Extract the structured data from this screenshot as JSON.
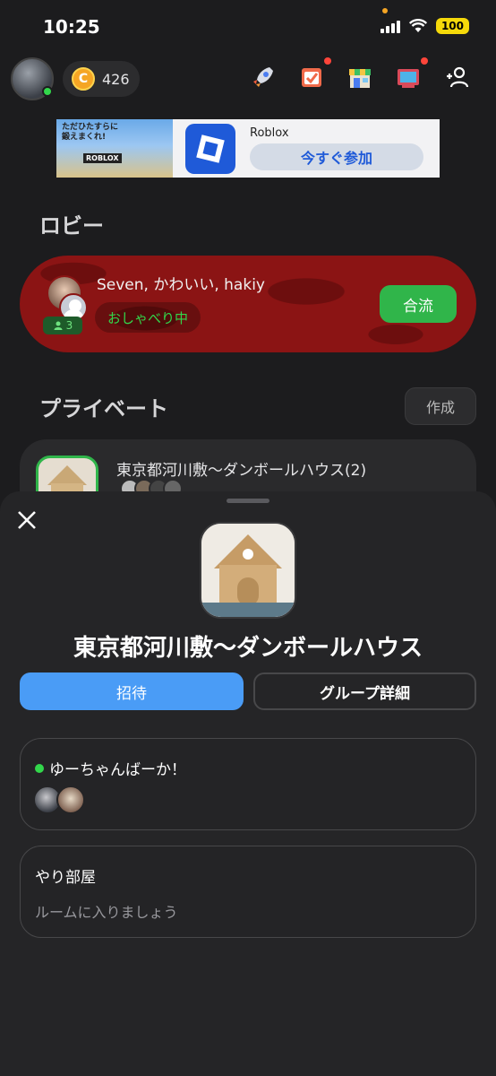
{
  "status_bar": {
    "time": "10:25",
    "battery": "100"
  },
  "header": {
    "coins": "426",
    "coin_symbol": "C",
    "icons": [
      "rocket-icon",
      "checklist-icon",
      "shop-icon",
      "tv-icon",
      "add-friend-icon"
    ]
  },
  "ad": {
    "thumb_text_line1": "ただひたすらに",
    "thumb_text_line2": "鍛えまくれ!",
    "thumb_brand": "ROBLOX",
    "title": "Roblox",
    "button": "今すぐ参加"
  },
  "lobby": {
    "title": "ロビー",
    "names": "Seven, かわいい, hakiy",
    "member_count": "3",
    "status": "おしゃべり中",
    "join": "合流"
  },
  "private": {
    "title": "プライベート",
    "create": "作成",
    "item_name": "東京都河川敷〜ダンボールハウス(2)"
  },
  "sheet": {
    "title": "東京都河川敷〜ダンボールハウス",
    "invite": "招待",
    "group_details": "グループ詳細",
    "rooms": [
      {
        "name": "ゆーちゃんばーか！",
        "active": true
      },
      {
        "name": "やり部屋",
        "subtitle": "ルームに入りましょう"
      }
    ]
  }
}
